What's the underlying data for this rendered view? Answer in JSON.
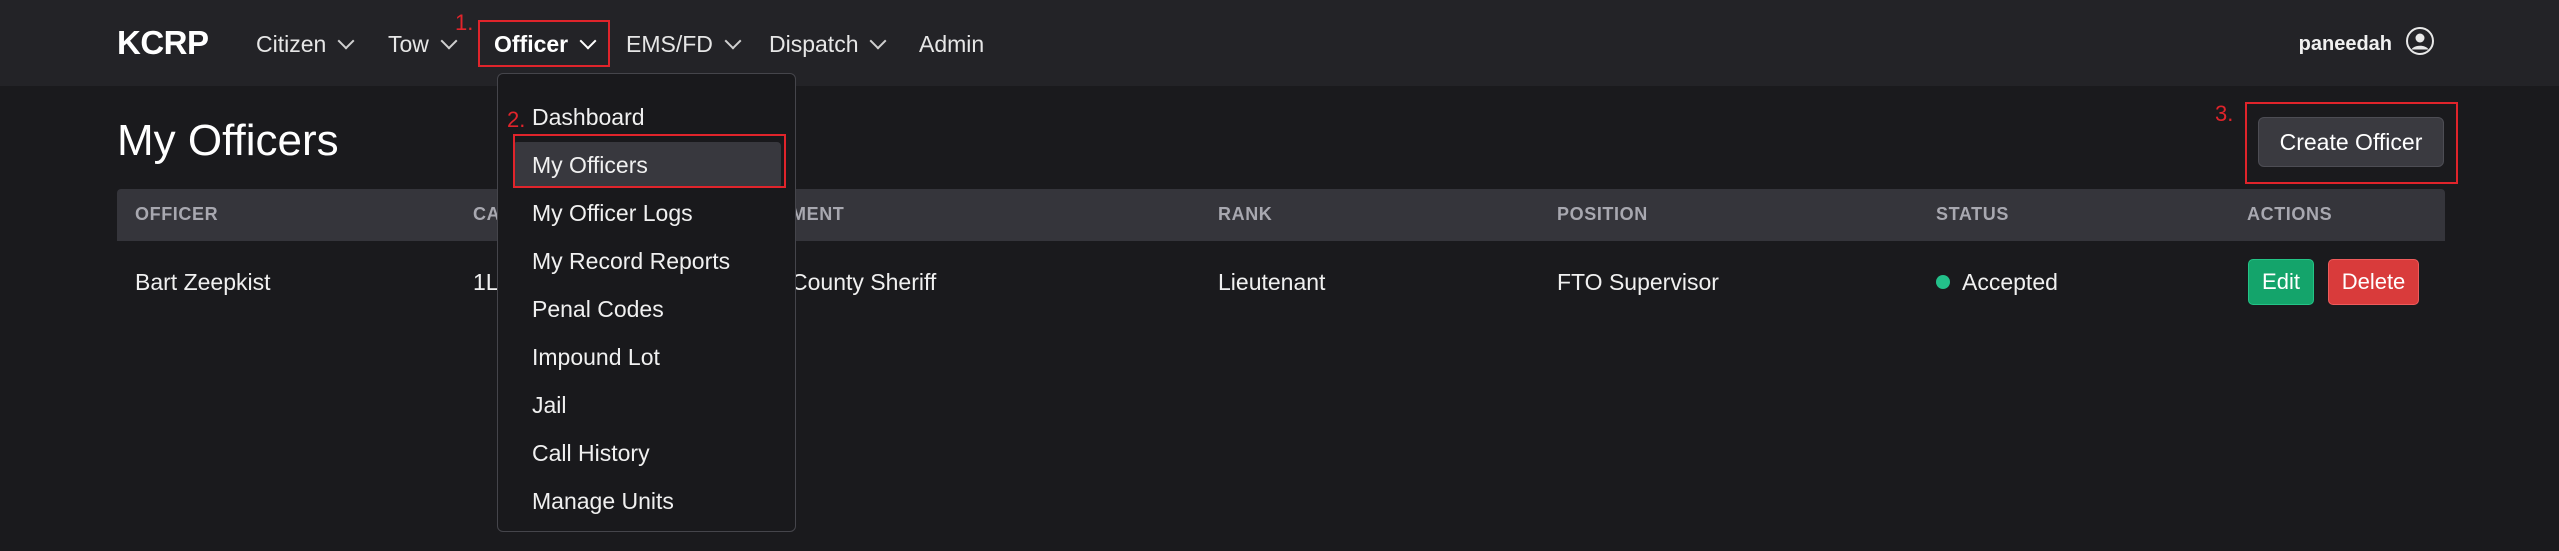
{
  "brand": "KCRP",
  "nav": {
    "items": [
      {
        "label": "Citizen"
      },
      {
        "label": "Tow"
      },
      {
        "label": "Officer"
      },
      {
        "label": "EMS/FD"
      },
      {
        "label": "Dispatch"
      },
      {
        "label": "Admin"
      }
    ],
    "active": "Officer"
  },
  "user": {
    "name": "paneedah"
  },
  "annotations": [
    "1.",
    "2.",
    "3."
  ],
  "page": {
    "title": "My Officers",
    "create_button": "Create Officer"
  },
  "table": {
    "columns": [
      "OFFICER",
      "CA",
      "MENT",
      "RANK",
      "POSITION",
      "STATUS",
      "ACTIONS"
    ],
    "rows": [
      {
        "officer": "Bart Zeepkist",
        "callsign": "1L",
        "department": "County Sheriff",
        "rank": "Lieutenant",
        "position": "FTO Supervisor",
        "status": "Accepted",
        "edit": "Edit",
        "delete": "Delete"
      }
    ]
  },
  "officer_menu": {
    "items": [
      {
        "label": "Dashboard"
      },
      {
        "label": "My Officers"
      },
      {
        "label": "My Officer Logs"
      },
      {
        "label": "My Record Reports"
      },
      {
        "label": "Penal Codes"
      },
      {
        "label": "Impound Lot"
      },
      {
        "label": "Jail"
      },
      {
        "label": "Call History"
      },
      {
        "label": "Manage Units"
      }
    ],
    "selected": "My Officers"
  },
  "colors": {
    "background": "#1a1a1d",
    "navbar": "#232327",
    "annotation": "#e0242b",
    "status_accepted": "#23c08a",
    "edit_button": "#14a46b",
    "delete_button": "#d93b3b"
  }
}
